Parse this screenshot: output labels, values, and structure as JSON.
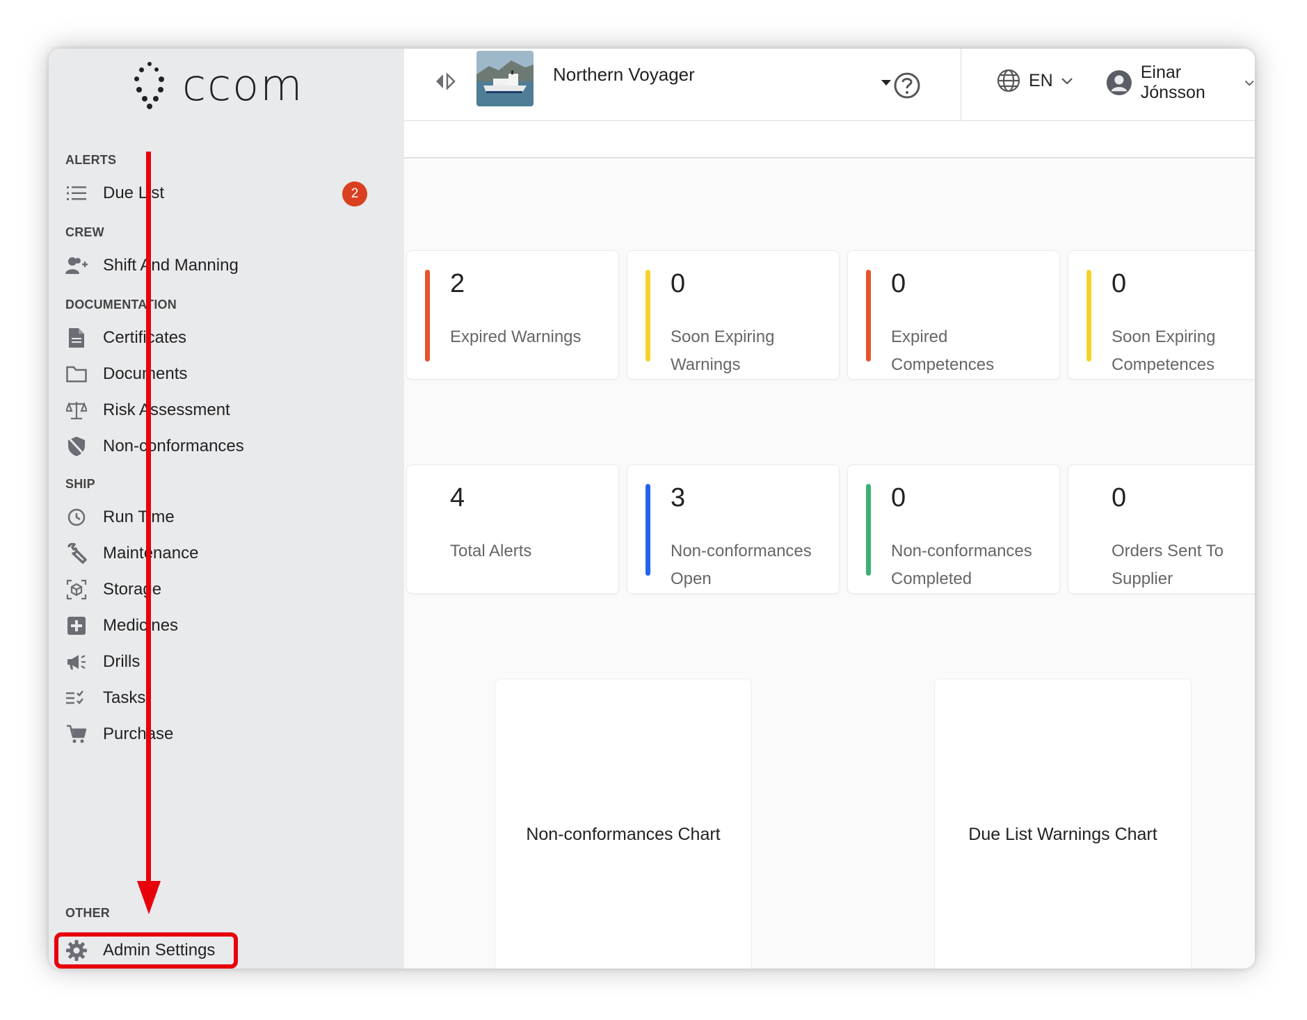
{
  "app": {
    "logo_text": "ccom"
  },
  "header": {
    "ship_name": "Northern Voyager",
    "language": "EN",
    "user_name": "Einar Jónsson"
  },
  "sidebar": {
    "sections": {
      "alerts": "ALERTS",
      "crew": "CREW",
      "documentation": "DOCUMENTATION",
      "ship": "SHIP",
      "other": "OTHER"
    },
    "items": {
      "due_list": "Due List",
      "due_list_badge": "2",
      "shift_and_manning": "Shift And Manning",
      "certificates": "Certificates",
      "documents": "Documents",
      "risk_assessment": "Risk Assessment",
      "non_conformances": "Non-conformances",
      "run_time": "Run Time",
      "maintenance": "Maintenance",
      "storage": "Storage",
      "medicines": "Medicines",
      "drills": "Drills",
      "tasks": "Tasks",
      "purchase": "Purchase",
      "admin_settings": "Admin Settings"
    }
  },
  "stats_row1": [
    {
      "value": "2",
      "label": "Expired Warnings",
      "color": "#e8532c"
    },
    {
      "value": "0",
      "label": "Soon Expiring Warnings",
      "color": "#f5d22a"
    },
    {
      "value": "0",
      "label": "Expired Competences",
      "color": "#e8532c"
    },
    {
      "value": "0",
      "label": "Soon Expiring Competences",
      "color": "#f5d22a"
    }
  ],
  "stats_row2": [
    {
      "value": "4",
      "label": "Total Alerts",
      "color": ""
    },
    {
      "value": "3",
      "label": "Non-conformances Open",
      "color": "#2463eb"
    },
    {
      "value": "0",
      "label": "Non-conformances Completed",
      "color": "#3bb273"
    },
    {
      "value": "0",
      "label": "Orders Sent To Supplier",
      "color": ""
    }
  ],
  "charts": {
    "non_conformances": "Non-conformances Chart",
    "due_list_warnings": "Due List Warnings Chart"
  },
  "colors": {
    "annotation": "#e8000b",
    "badge": "#d9401f",
    "sidebar_bg": "#e9eaec"
  }
}
